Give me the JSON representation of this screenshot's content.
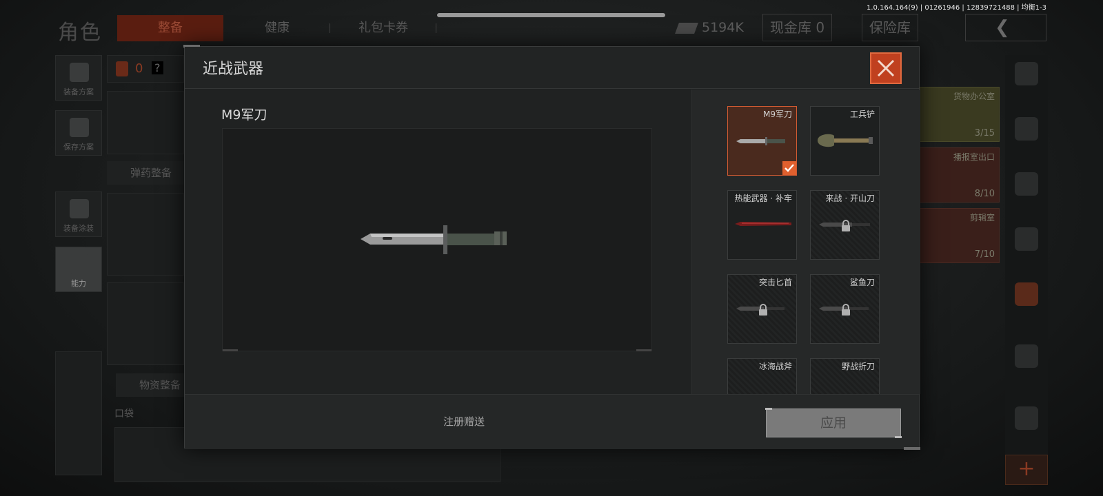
{
  "status_bar": {
    "version": "1.0.164.164(9) | 01261946 | 12839721488 | 均衡1-3"
  },
  "background": {
    "page_title": "角色",
    "tabs": [
      {
        "label": "整备"
      },
      {
        "label": "健康"
      },
      {
        "label": "礼包卡券"
      }
    ],
    "currency": "5194K",
    "cash_vault": "现金库 0",
    "insurance_vault": "保险库",
    "left_menu": [
      {
        "label": "装备方案"
      },
      {
        "label": "保存方案"
      },
      {
        "label": "装备涂装"
      },
      {
        "label": "能力"
      }
    ],
    "slot_count": "0",
    "slot_help": "?",
    "sections": {
      "ammo": "弹药整备",
      "supplies": "物资整备",
      "pocket": "口袋"
    },
    "key_cards": [
      {
        "name": "货物办公室",
        "count": "3/15"
      },
      {
        "name": "播报室出口",
        "count": "8/10"
      },
      {
        "name": "剪辑室",
        "count": "7/10"
      }
    ]
  },
  "modal": {
    "title": "近战武器",
    "selected_name": "M9军刀",
    "weapons": [
      {
        "name": "M9军刀",
        "state": "selected"
      },
      {
        "name": "工兵铲",
        "state": "owned"
      },
      {
        "name": "热能武器 · 补牢",
        "state": "owned"
      },
      {
        "name": "来战 · 开山刀",
        "state": "locked"
      },
      {
        "name": "突击匕首",
        "state": "locked"
      },
      {
        "name": "鲨鱼刀",
        "state": "locked"
      },
      {
        "name": "冰海战斧",
        "state": "locked"
      },
      {
        "name": "野战折刀",
        "state": "locked"
      }
    ],
    "footer_note": "注册赠送",
    "apply_label": "应用"
  },
  "colors": {
    "accent": "#e0602e",
    "selected_bg": "#4a2a1e",
    "apply_disabled": "#7a7a7a"
  },
  "icons": [
    "close-icon",
    "check-icon",
    "lock-icon",
    "back-icon",
    "plus-icon",
    "cash-icon"
  ]
}
